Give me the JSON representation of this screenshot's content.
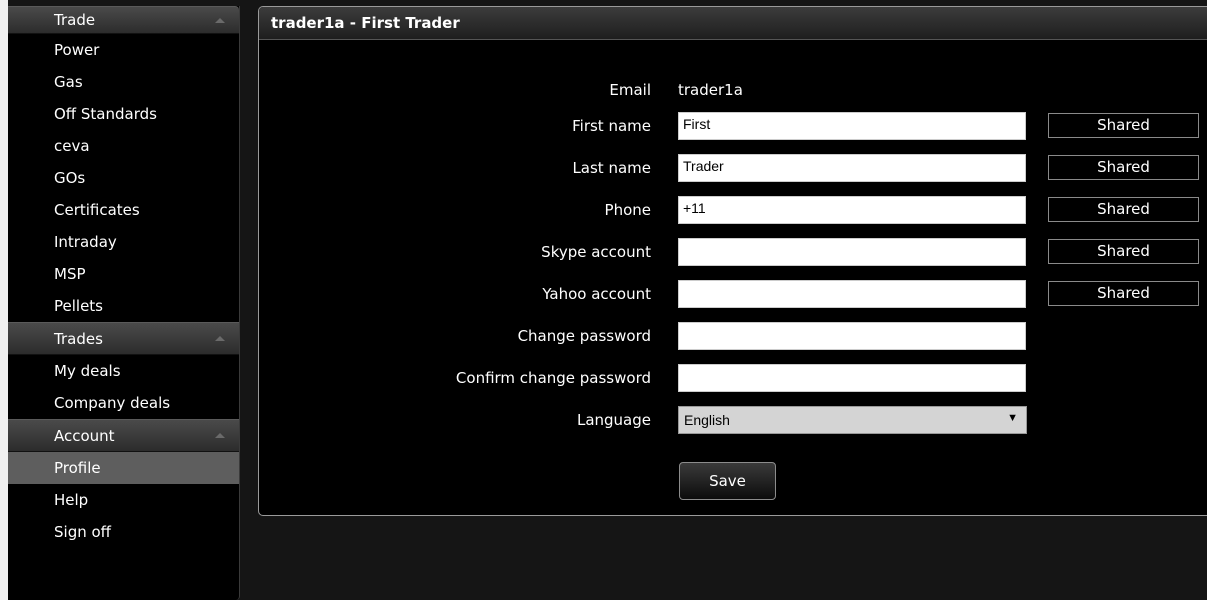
{
  "sidebar": {
    "trade": {
      "title": "Trade",
      "items": [
        "Power",
        "Gas",
        "Off Standards",
        "ceva",
        "GOs",
        "Certificates",
        "Intraday",
        "MSP",
        "Pellets"
      ]
    },
    "trades": {
      "title": "Trades",
      "items": [
        "My deals",
        "Company deals"
      ]
    },
    "account": {
      "title": "Account",
      "items": [
        "Profile",
        "Help",
        "Sign off"
      ],
      "active": "Profile"
    }
  },
  "panel": {
    "title": "trader1a - First Trader",
    "email": {
      "label": "Email",
      "value": "trader1a"
    },
    "first_name": {
      "label": "First name",
      "value": "First",
      "shared": "Shared"
    },
    "last_name": {
      "label": "Last name",
      "value": "Trader",
      "shared": "Shared"
    },
    "phone": {
      "label": "Phone",
      "value": "+11",
      "shared": "Shared"
    },
    "skype": {
      "label": "Skype account",
      "value": "",
      "shared": "Shared"
    },
    "yahoo": {
      "label": "Yahoo account",
      "value": "",
      "shared": "Shared"
    },
    "change_password": {
      "label": "Change password",
      "value": ""
    },
    "confirm_password": {
      "label": "Confirm change password",
      "value": ""
    },
    "language": {
      "label": "Language",
      "value": "English"
    },
    "save_label": "Save"
  }
}
